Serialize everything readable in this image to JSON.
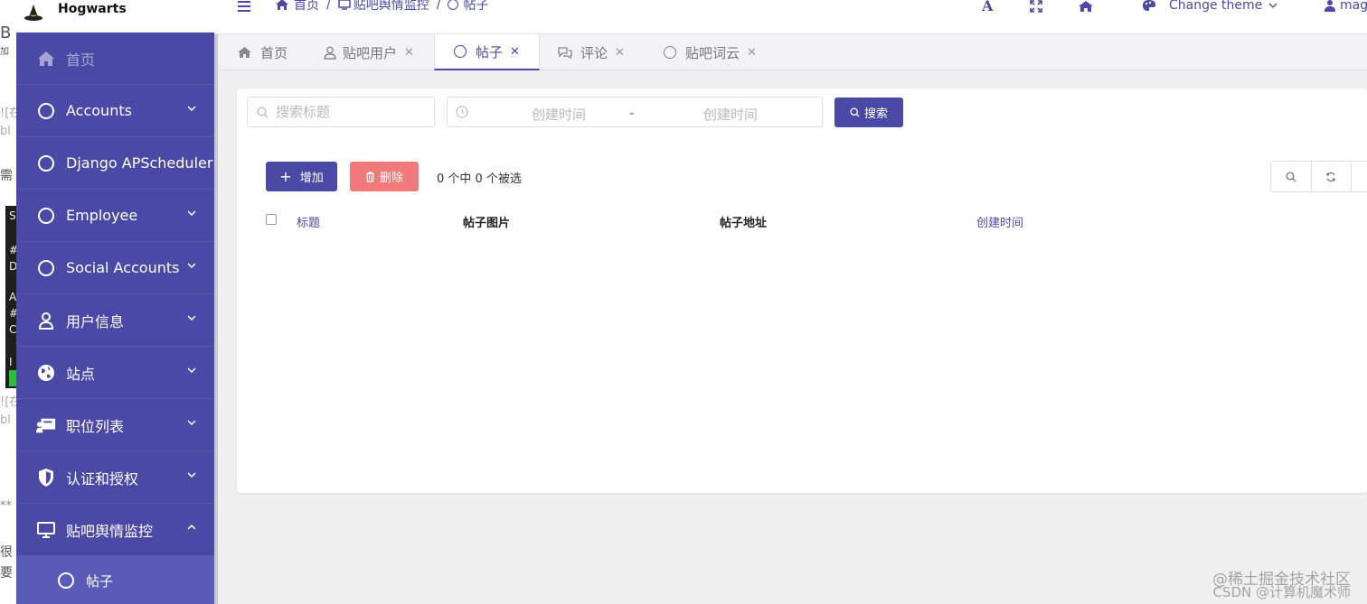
{
  "background_window": {
    "fragments": [
      "B",
      "加",
      "![在",
      "bl",
      "需",
      "S",
      "#",
      "D",
      "A",
      "#",
      "C",
      "I",
      "![在",
      "bl",
      "**",
      "很",
      "要"
    ]
  },
  "app": {
    "title": "Hogwarts"
  },
  "sidebar": {
    "items": [
      {
        "label": "首页",
        "icon": "home-icon"
      },
      {
        "label": "Accounts",
        "icon": "circle-icon"
      },
      {
        "label": "Django APScheduler",
        "icon": "circle-icon"
      },
      {
        "label": "Employee",
        "icon": "circle-icon"
      },
      {
        "label": "Social Accounts",
        "icon": "circle-icon"
      },
      {
        "label": "用户信息",
        "icon": "user-icon"
      },
      {
        "label": "站点",
        "icon": "globe-icon"
      },
      {
        "label": "职位列表",
        "icon": "presentation-icon"
      },
      {
        "label": "认证和授权",
        "icon": "shield-icon"
      },
      {
        "label": "贴吧舆情监控",
        "icon": "monitor-icon"
      }
    ],
    "sub_item": {
      "label": "帖子",
      "icon": "circle-icon"
    },
    "accent": "#4a4aa6"
  },
  "topbar": {
    "breadcrumb": [
      "首页",
      "贴吧舆情监控",
      "帖子"
    ],
    "theme_label": "Change theme",
    "user_label": "mag"
  },
  "tabs": [
    {
      "label": "首页",
      "icon": "home-icon",
      "closable": false
    },
    {
      "label": "贴吧用户",
      "icon": "user-icon",
      "closable": true
    },
    {
      "label": "帖子",
      "icon": "circle-icon",
      "closable": true,
      "active": true
    },
    {
      "label": "评论",
      "icon": "comments-icon",
      "closable": true
    },
    {
      "label": "贴吧词云",
      "icon": "circle-icon",
      "closable": true
    }
  ],
  "filters": {
    "search_placeholder": "搜索标题",
    "date_start_placeholder": "创建时间",
    "date_sep": "-",
    "date_end_placeholder": "创建时间",
    "search_button": "搜索"
  },
  "actions": {
    "add_button": "增加",
    "delete_button": "删除",
    "selection_info": "0 个中 0 个被选"
  },
  "table": {
    "columns": [
      "标题",
      "帖子图片",
      "帖子地址",
      "创建时间"
    ]
  },
  "watermark": {
    "line1": "@稀土掘金技术社区",
    "line2": "CSDN @计算机魔术师"
  },
  "colors": {
    "primary": "#4a4aa6",
    "danger": "#f07a7a"
  }
}
